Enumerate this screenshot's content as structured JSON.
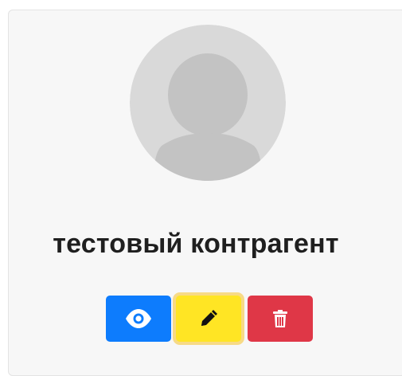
{
  "card": {
    "title": "тестовый контрагент"
  },
  "avatar": {
    "icon": "user-placeholder-icon"
  },
  "actions": [
    {
      "name": "view",
      "icon": "eye-icon",
      "color": "#0d7cfd"
    },
    {
      "name": "edit",
      "icon": "pencil-icon",
      "color": "#ffe524"
    },
    {
      "name": "delete",
      "icon": "trash-icon",
      "color": "#df3747"
    }
  ]
}
